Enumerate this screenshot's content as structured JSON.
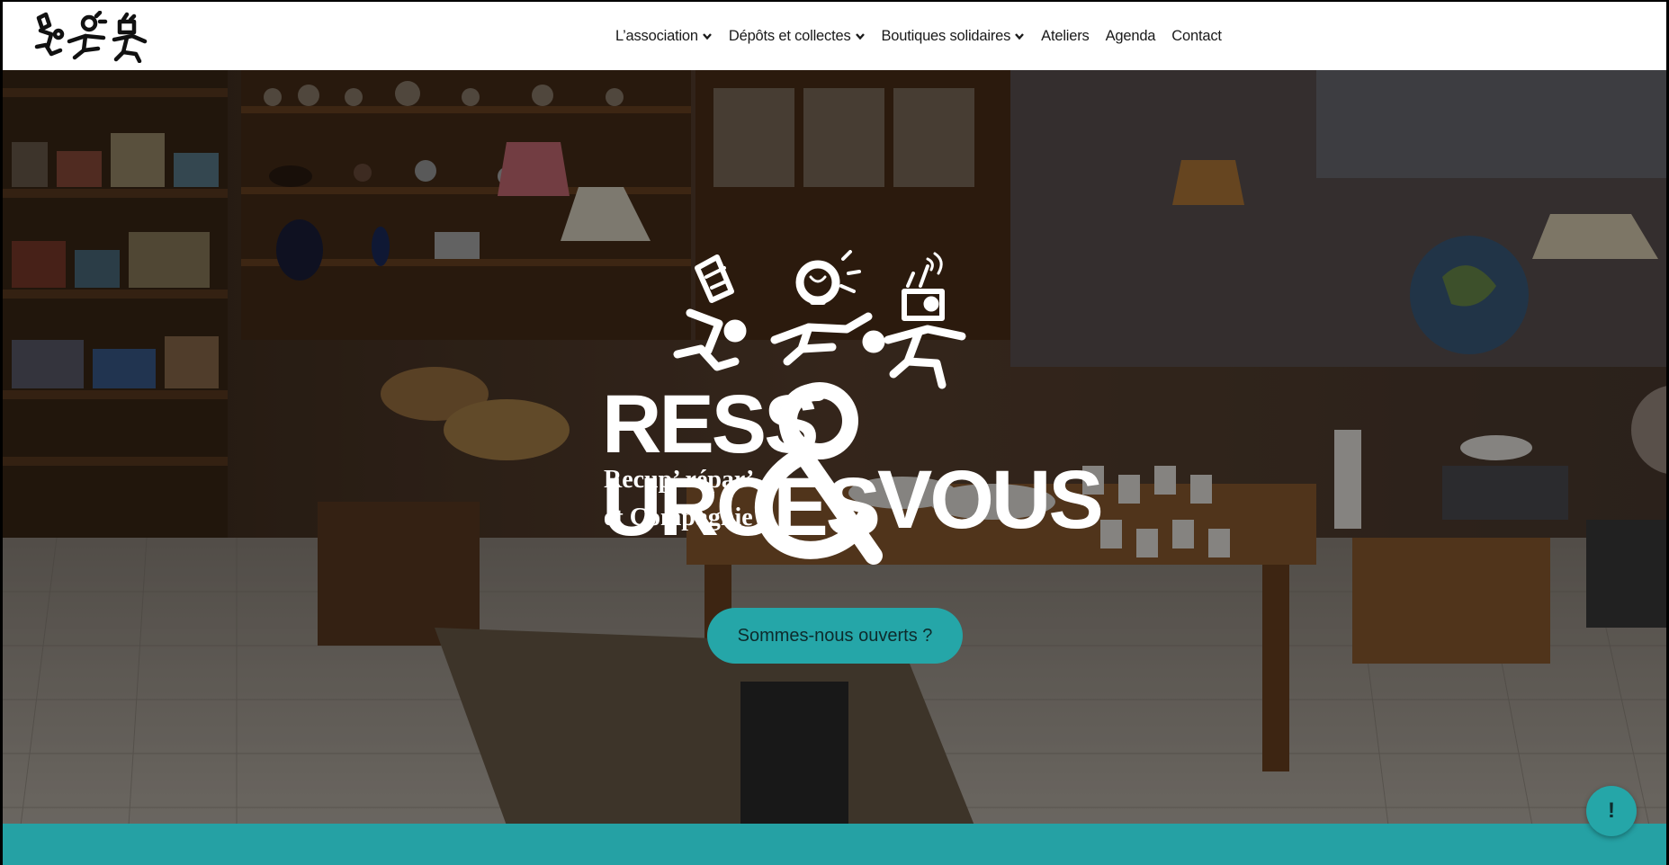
{
  "nav": {
    "items": [
      {
        "label": "L’association",
        "has_dropdown": true
      },
      {
        "label": "Dépôts et collectes",
        "has_dropdown": true
      },
      {
        "label": "Boutiques solidaires",
        "has_dropdown": true
      },
      {
        "label": "Ateliers",
        "has_dropdown": false
      },
      {
        "label": "Agenda",
        "has_dropdown": false
      },
      {
        "label": "Contact",
        "has_dropdown": false
      }
    ]
  },
  "hero": {
    "brand_word_1": "RESS",
    "brand_word_1b": "URCES",
    "brand_word_2": "VOUS",
    "brand_sub_1": "Recup’ répar’",
    "brand_sub_2": "et Compagnie",
    "cta_label": "Sommes-nous ouverts ?"
  },
  "fab_label": "!",
  "colors": {
    "accent": "#25a6a8",
    "band": "#25a1a4",
    "header_bg": "#ffffff",
    "nav_text": "#1a1a1a"
  },
  "icons": {
    "logo": "ressources-et-vous-logo",
    "chevron": "chevron-down-icon",
    "chair": "chair-figure-icon",
    "bulb": "lightbulb-figure-icon",
    "radio": "radio-figure-icon"
  }
}
